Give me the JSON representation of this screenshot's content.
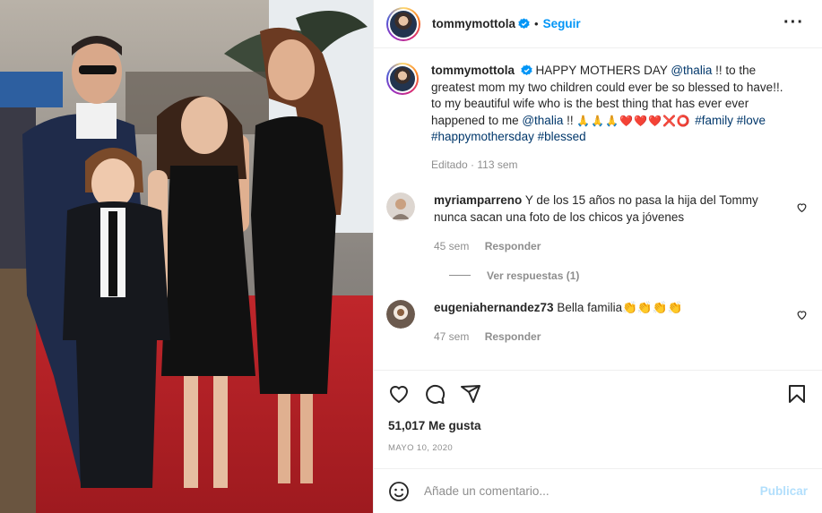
{
  "post": {
    "username": "tommymottola",
    "follow_label": "Seguir",
    "dot": "•",
    "more_icon": "more-options-icon",
    "caption": {
      "part1": "HAPPY MOTHERS DAY ",
      "mention1": "@thalia",
      "part2": " !! to the greatest mom my two children could ever be so blessed to have!!. to my beautiful wife who is the best thing that has ever ever happened to me ",
      "mention2": "@thalia",
      "part3": " !! ",
      "emojis": "🙏🙏🙏❤️❤️❤️❌⭕ ",
      "tags": [
        "#family",
        "#love",
        "#happymothersday",
        "#blessed"
      ]
    },
    "caption_meta": "Editado · 113 sem"
  },
  "comments": [
    {
      "username": "myriamparreno",
      "text": "Y de los 15 años no pasa la hija del Tommy nunca sacan una foto de los chicos ya jóvenes",
      "age": "45 sem",
      "reply_label": "Responder",
      "view_replies": "Ver respuestas (1)"
    },
    {
      "username": "eugeniahernandez73",
      "text": "Bella familia👏👏👏👏",
      "age": "47 sem",
      "reply_label": "Responder"
    }
  ],
  "likes": "51,017 Me gusta",
  "date": "MAYO 10, 2020",
  "add_comment": {
    "placeholder": "Añade un comentario...",
    "publish_label": "Publicar"
  },
  "colors": {
    "accent": "#0095f6",
    "link": "#00376b",
    "muted": "#8e8e8e",
    "publish_disabled": "#b2dffc"
  }
}
